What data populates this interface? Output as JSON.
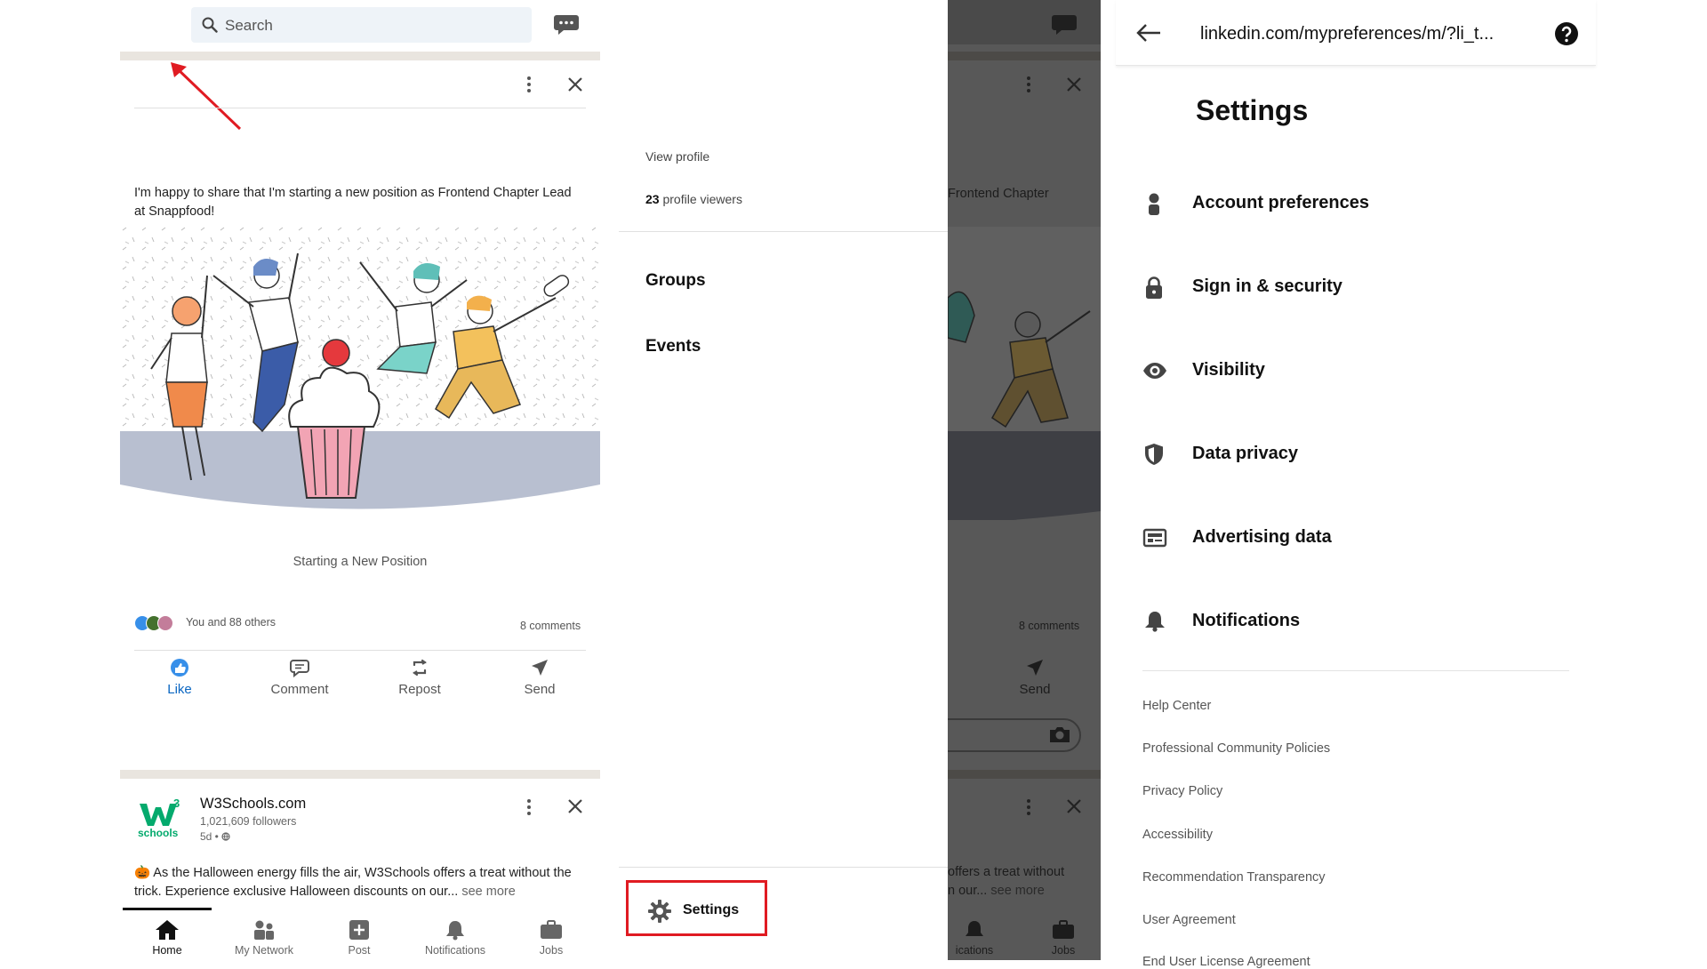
{
  "feed": {
    "search_placeholder": "Search",
    "post": {
      "text": "I'm happy to share that I'm starting a new position as Frontend Chapter Lead at Snappfood!",
      "caption": "Starting a New Position",
      "reactions": "You and 88 others",
      "comments": "8 comments",
      "actions": {
        "like": "Like",
        "comment": "Comment",
        "repost": "Repost",
        "send": "Send"
      }
    },
    "w3": {
      "logo_text": "schools",
      "logo_sup": "3",
      "name": "W3Schools.com",
      "followers": "1,021,609 followers",
      "time": "5d •",
      "text": "🎃 As the Halloween energy fills the air, W3Schools offers a treat without the trick. Experience exclusive Halloween discounts on our...",
      "see_more": "see more"
    },
    "nav": {
      "home": "Home",
      "network": "My Network",
      "post": "Post",
      "notifications": "Notifications",
      "jobs": "Jobs"
    },
    "accent_color": "#0a66c2"
  },
  "drawer": {
    "view_profile": "View profile",
    "viewers_count": "23",
    "viewers_label": "profile viewers",
    "groups": "Groups",
    "events": "Events",
    "settings": "Settings"
  },
  "dimmed": {
    "text_fragment": "Frontend Chapter",
    "comments": "8 comments",
    "send": "Send",
    "w3_fragment_1": "offers a treat without",
    "w3_fragment_2": "n our...",
    "see_more": "see more",
    "notifications_fragment": "ications",
    "jobs": "Jobs"
  },
  "settings": {
    "url": "linkedin.com/mypreferences/m/?li_t...",
    "title": "Settings",
    "items": [
      {
        "label": "Account preferences",
        "icon": "person-icon"
      },
      {
        "label": "Sign in & security",
        "icon": "lock-icon"
      },
      {
        "label": "Visibility",
        "icon": "eye-icon"
      },
      {
        "label": "Data privacy",
        "icon": "shield-icon"
      },
      {
        "label": "Advertising data",
        "icon": "ad-icon"
      },
      {
        "label": "Notifications",
        "icon": "bell-icon"
      }
    ],
    "links": [
      "Help Center",
      "Professional Community Policies",
      "Privacy Policy",
      "Accessibility",
      "Recommendation Transparency",
      "User Agreement",
      "End User License Agreement"
    ]
  },
  "highlight_color": "#e01b22"
}
